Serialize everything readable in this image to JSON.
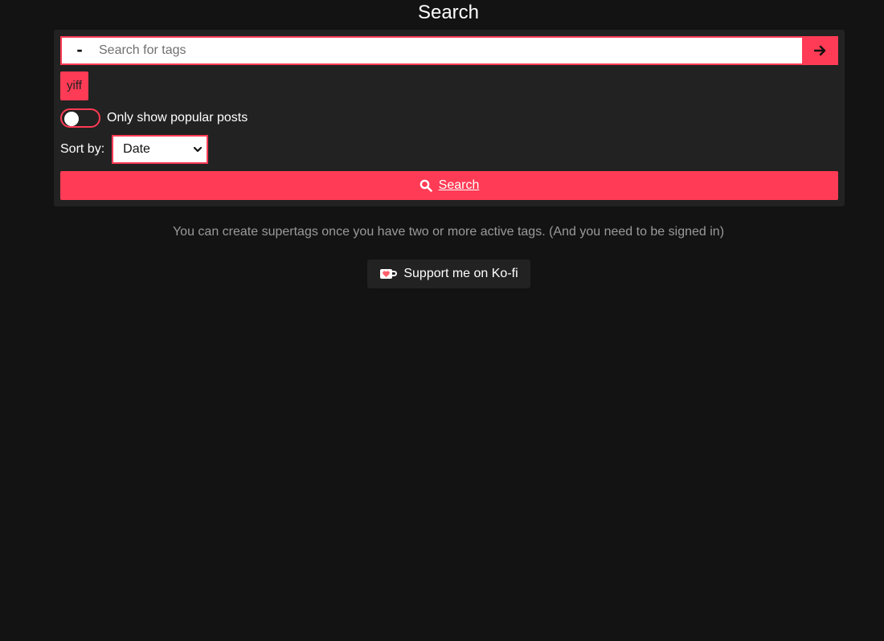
{
  "header": {
    "title": "Search"
  },
  "search": {
    "exclude_toggle": "-",
    "placeholder": "Search for tags",
    "value": "",
    "submit_icon": "arrow-right-icon"
  },
  "active_tags": [
    {
      "label": "yiff"
    }
  ],
  "filters": {
    "popular_only_label": "Only show popular posts",
    "popular_only_enabled": false,
    "sort_label": "Sort by:",
    "sort_value": "Date"
  },
  "actions": {
    "search_label": "Search",
    "search_icon": "magnifier-icon"
  },
  "info": {
    "supertags_text": "You can create supertags once you have two or more active tags. (And you need to be signed in)"
  },
  "kofi": {
    "label": "Support me on Ko-fi",
    "icon": "coffee-cup-heart-icon"
  },
  "colors": {
    "accent": "#ff3b55",
    "background": "#131313",
    "panel": "#222222",
    "muted_text": "#9a9a9a"
  }
}
